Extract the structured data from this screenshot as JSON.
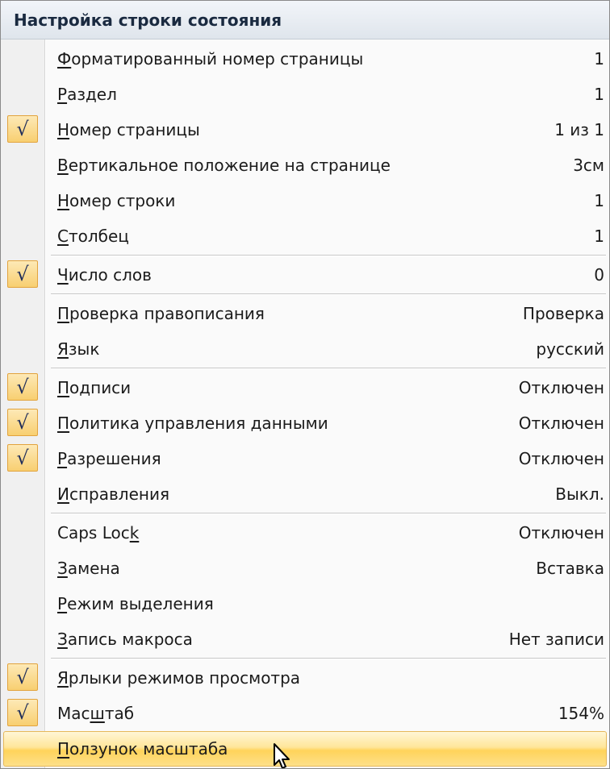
{
  "menu": {
    "title": "Настройка строки состояния",
    "groups": [
      {
        "items": [
          {
            "pre": "",
            "key": "Ф",
            "post": "орматированный номер страницы",
            "value": "1",
            "checked": false
          },
          {
            "pre": "",
            "key": "Р",
            "post": "аздел",
            "value": "1",
            "checked": false
          },
          {
            "pre": "",
            "key": "Н",
            "post": "омер страницы",
            "value": "1 из 1",
            "checked": true
          },
          {
            "pre": "",
            "key": "В",
            "post": "ертикальное положение на странице",
            "value": "3см",
            "checked": false
          },
          {
            "pre": "",
            "key": "Н",
            "post": "омер строки",
            "value": "1",
            "checked": false
          },
          {
            "pre": "",
            "key": "С",
            "post": "толбец",
            "value": "1",
            "checked": false
          }
        ]
      },
      {
        "items": [
          {
            "pre": "",
            "key": "Ч",
            "post": "исло слов",
            "value": "0",
            "checked": true
          }
        ]
      },
      {
        "items": [
          {
            "pre": "",
            "key": "П",
            "post": "роверка правописания",
            "value": "Проверка",
            "checked": false
          },
          {
            "pre": "",
            "key": "Я",
            "post": "зык",
            "value": "русский",
            "checked": false
          }
        ]
      },
      {
        "items": [
          {
            "pre": "",
            "key": "П",
            "post": "одписи",
            "value": "Отключен",
            "checked": true
          },
          {
            "pre": "",
            "key": "П",
            "post": "олитика управления данными",
            "value": "Отключен",
            "checked": true
          },
          {
            "pre": "",
            "key": "Р",
            "post": "азрешения",
            "value": "Отключен",
            "checked": true
          },
          {
            "pre": "",
            "key": "И",
            "post": "справления",
            "value": "Выкл.",
            "checked": false
          }
        ]
      },
      {
        "items": [
          {
            "pre": "Caps Loc",
            "key": "k",
            "post": "",
            "value": "Отключен",
            "checked": false
          },
          {
            "pre": "",
            "key": "З",
            "post": "амена",
            "value": "Вставка",
            "checked": false
          },
          {
            "pre": "",
            "key": "Р",
            "post": "ежим выделения",
            "value": "",
            "checked": false
          },
          {
            "pre": "",
            "key": "З",
            "post": "апись макроса",
            "value": "Нет записи",
            "checked": false
          }
        ]
      },
      {
        "items": [
          {
            "pre": "",
            "key": "Я",
            "post": "рлыки режимов просмотра",
            "value": "",
            "checked": true
          },
          {
            "pre": "Мас",
            "key": "ш",
            "post": "таб",
            "value": "154%",
            "checked": true
          },
          {
            "pre": "",
            "key": "П",
            "post": "олзунок масштаба",
            "value": "",
            "checked": false,
            "highlighted": true
          }
        ]
      }
    ]
  },
  "icons": {
    "check": "checkmark-icon",
    "cursor": "mouse-pointer-icon",
    "check_glyph": "√"
  },
  "colors": {
    "check_fill": "#f8cf71",
    "check_border": "#e2a33d",
    "highlight": "#ffd35a",
    "header_bg": "#dfe5ec"
  }
}
